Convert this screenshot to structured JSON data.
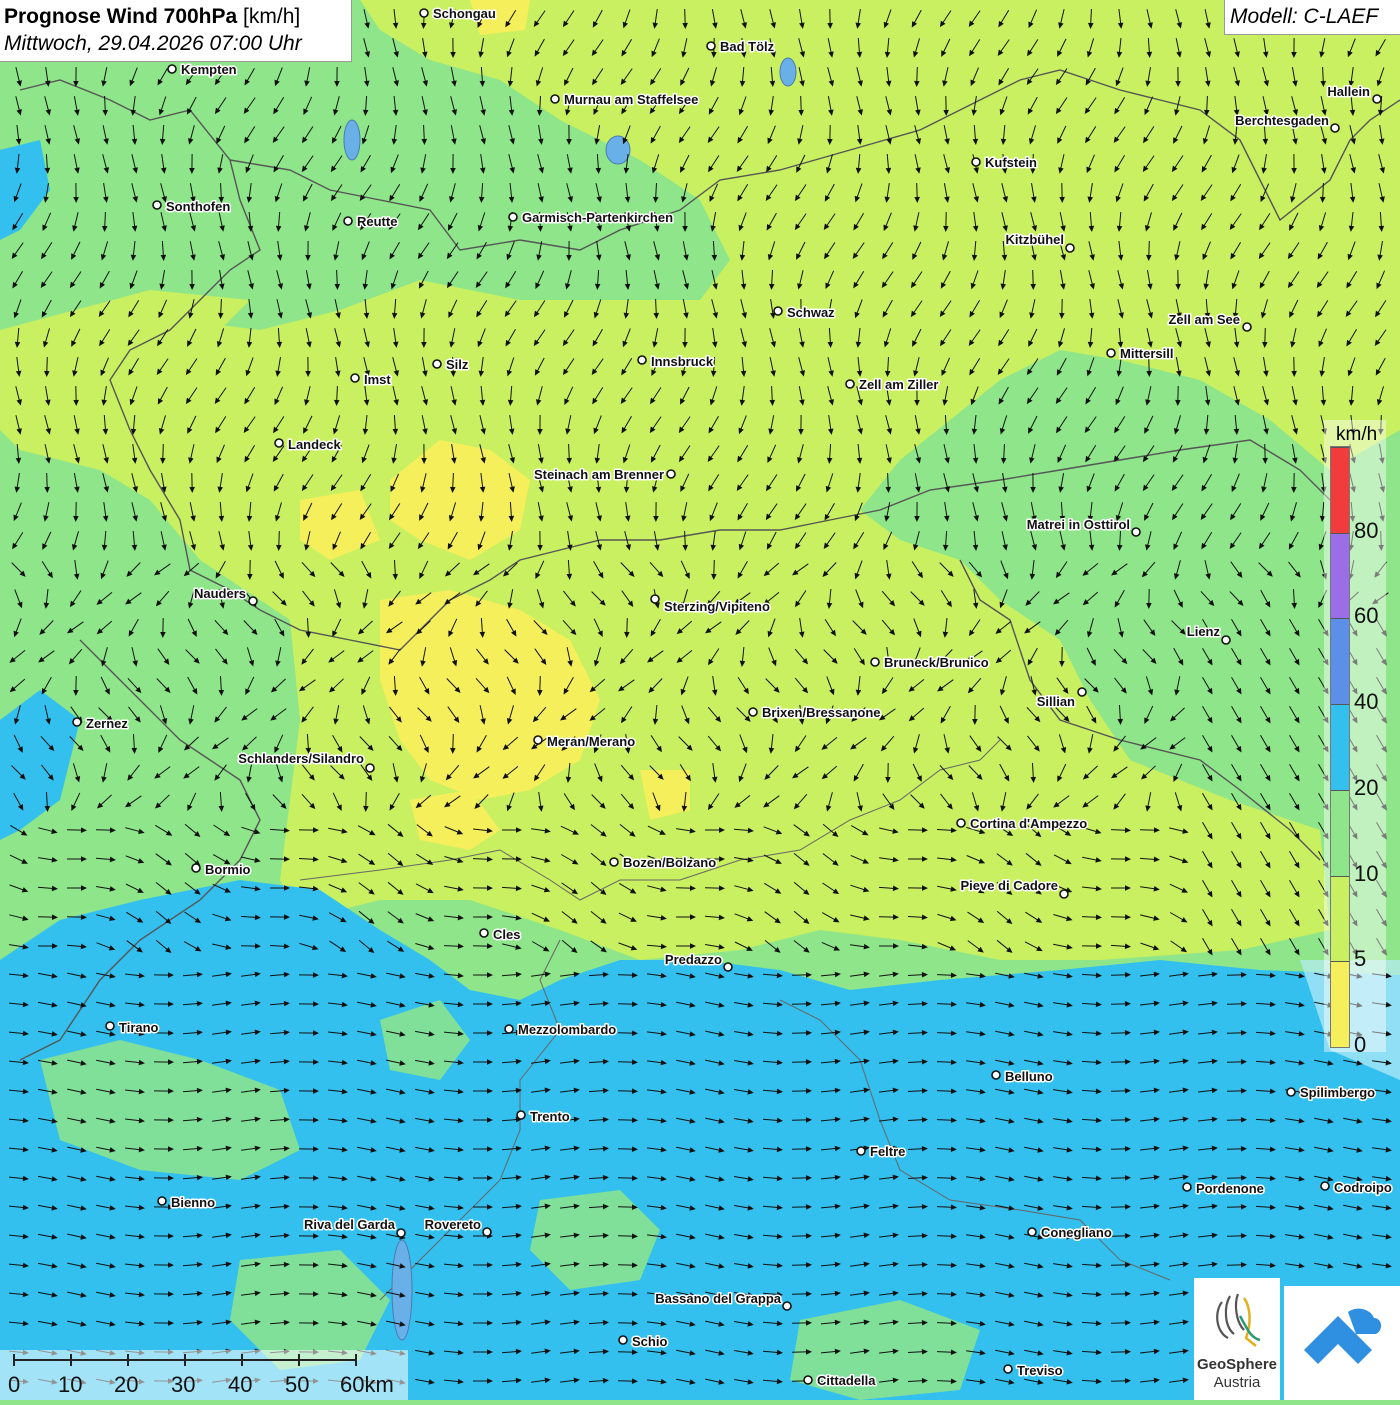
{
  "header": {
    "title_bold": "Prognose Wind 700hPa",
    "title_unit": "[km/h]",
    "datetime": "Mittwoch, 29.04.2026 07:00 Uhr",
    "model": "Modell: C-LAEF"
  },
  "legend": {
    "unit": "km/h",
    "ticks": [
      "0",
      "5",
      "10",
      "20",
      "40",
      "60",
      "80"
    ],
    "colors": [
      "#f6ef5c",
      "#c9f060",
      "#8ee58a",
      "#33c0ef",
      "#5b8fe8",
      "#9a6ee6",
      "#f23b3b"
    ]
  },
  "scale": {
    "labels": [
      "0",
      "10",
      "20",
      "30",
      "40",
      "50",
      "60km"
    ]
  },
  "cities": [
    {
      "name": "Schongau"
    },
    {
      "name": "Bad Tölz"
    },
    {
      "name": "Kempten"
    },
    {
      "name": "Murnau am Staffelsee"
    },
    {
      "name": "Hallein"
    },
    {
      "name": "Berchtesgaden"
    },
    {
      "name": "Kufstein"
    },
    {
      "name": "Sonthofen"
    },
    {
      "name": "Reutte"
    },
    {
      "name": "Garmisch-Partenkirchen"
    },
    {
      "name": "Kitzbühel"
    },
    {
      "name": "Schwaz"
    },
    {
      "name": "Zell am See"
    },
    {
      "name": "Mittersill"
    },
    {
      "name": "Silz"
    },
    {
      "name": "Innsbruck"
    },
    {
      "name": "Imst"
    },
    {
      "name": "Zell am Ziller"
    },
    {
      "name": "Landeck"
    },
    {
      "name": "Steinach am Brenner"
    },
    {
      "name": "Matrei in Osttirol"
    },
    {
      "name": "Nauders"
    },
    {
      "name": "Sterzing/Vipiteno"
    },
    {
      "name": "Lienz"
    },
    {
      "name": "Bruneck/Brunico"
    },
    {
      "name": "Sillian"
    },
    {
      "name": "Zernez"
    },
    {
      "name": "Brixen/Bressanone"
    },
    {
      "name": "Meran/Merano"
    },
    {
      "name": "Schlanders/Silandro"
    },
    {
      "name": "Cortina d'Ampezzo"
    },
    {
      "name": "Bozen/Bolzano"
    },
    {
      "name": "Bormio"
    },
    {
      "name": "Pieve di Cadore"
    },
    {
      "name": "Cles"
    },
    {
      "name": "Predazzo"
    },
    {
      "name": "Tirano"
    },
    {
      "name": "Mezzolombardo"
    },
    {
      "name": "Belluno"
    },
    {
      "name": "Spilimbergo"
    },
    {
      "name": "Trento"
    },
    {
      "name": "Feltre"
    },
    {
      "name": "Bienno"
    },
    {
      "name": "Pordenone"
    },
    {
      "name": "Codroipo"
    },
    {
      "name": "Riva del Garda"
    },
    {
      "name": "Rovereto"
    },
    {
      "name": "Conegliano"
    },
    {
      "name": "Bassano del Grappa"
    },
    {
      "name": "Schio"
    },
    {
      "name": "Treviso"
    },
    {
      "name": "Cittadella"
    }
  ],
  "branding": {
    "logo_line1": "GeoSphere",
    "logo_line2": "Austria"
  }
}
